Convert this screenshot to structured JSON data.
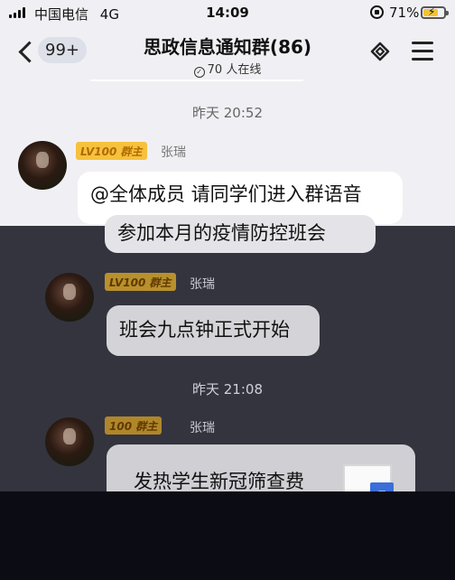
{
  "status_bar": {
    "carrier": "中国电信",
    "network": "4G",
    "time": "14:09",
    "battery_percent": "71%",
    "battery_level": 0.71
  },
  "header": {
    "unread_count": "99+",
    "title": "思政信息通知群(86)",
    "online_text": "70 人在线"
  },
  "messages": [
    {
      "type": "timestamp",
      "text": "昨天 20:52"
    },
    {
      "type": "message",
      "badge": "LV100 群主",
      "sender": "张瑞",
      "line1": "@全体成员 请同学们进入群语音",
      "line2": "参加本月的疫情防控班会"
    },
    {
      "type": "message",
      "badge": "LV100 群主",
      "sender": "张瑞",
      "text": "班会九点钟正式开始"
    },
    {
      "type": "timestamp",
      "text": "昨天 21:08"
    },
    {
      "type": "message",
      "badge": "100 群主",
      "sender": "张瑞",
      "text": "发热学生新冠筛查费"
    }
  ],
  "colors": {
    "background": "#f0f0f4",
    "bubble": "#ffffff",
    "owner_badge": "#f6c13c",
    "overlay": "#2a2a38"
  }
}
